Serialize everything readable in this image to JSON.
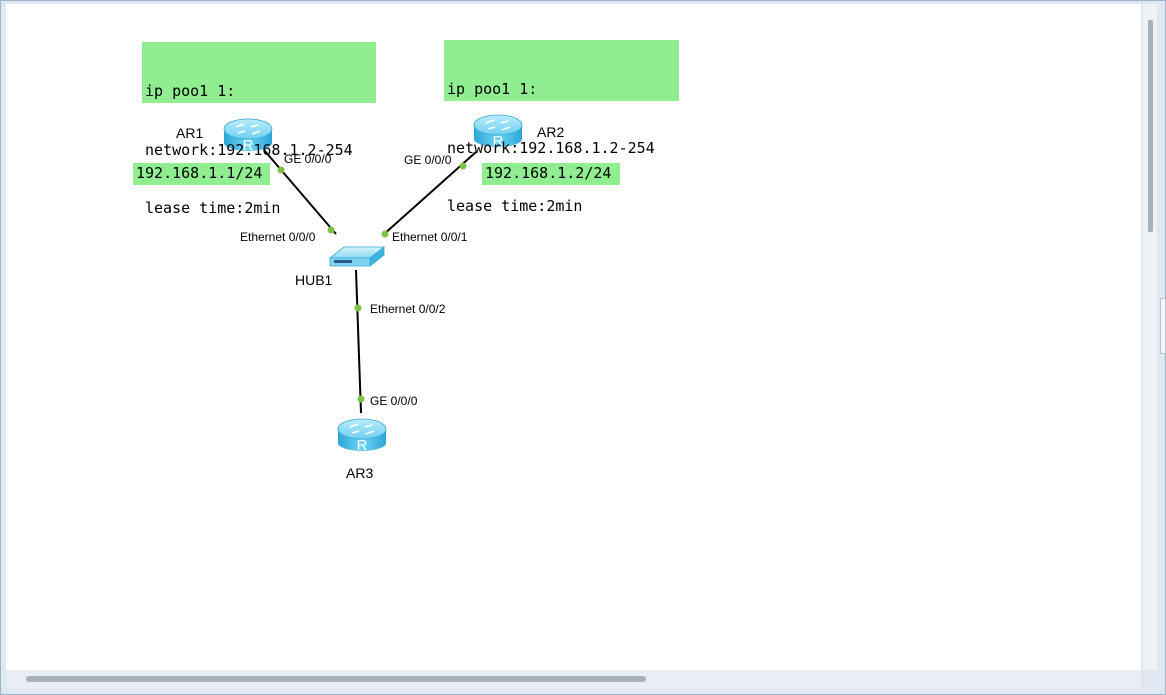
{
  "notes": [
    {
      "id": "ar1-dhcp",
      "lines": [
        "ip poo1 1:",
        "network:192.168.1.2-254",
        "lease time:2min"
      ]
    },
    {
      "id": "ar2-dhcp",
      "lines": [
        "ip poo1 1:",
        "network:192.168.1.2-254",
        "lease time:2min"
      ]
    }
  ],
  "ip_labels": {
    "ar1": "192.168.1.1/24",
    "ar2": "192.168.1.2/24"
  },
  "devices": {
    "ar1": "AR1",
    "ar2": "AR2",
    "ar3": "AR3",
    "hub1": "HUB1"
  },
  "ports": {
    "ar1_ge": "GE 0/0/0",
    "ar2_ge": "GE 0/0/0",
    "ar3_ge": "GE 0/0/0",
    "hub_e0": "Ethernet 0/0/0",
    "hub_e1": "Ethernet 0/0/1",
    "hub_e2": "Ethernet 0/0/2"
  },
  "colors": {
    "note_bg": "#90ee90",
    "router_blue": "#4fc3ec",
    "link": "#000000",
    "port_dot": "#7dc242"
  }
}
